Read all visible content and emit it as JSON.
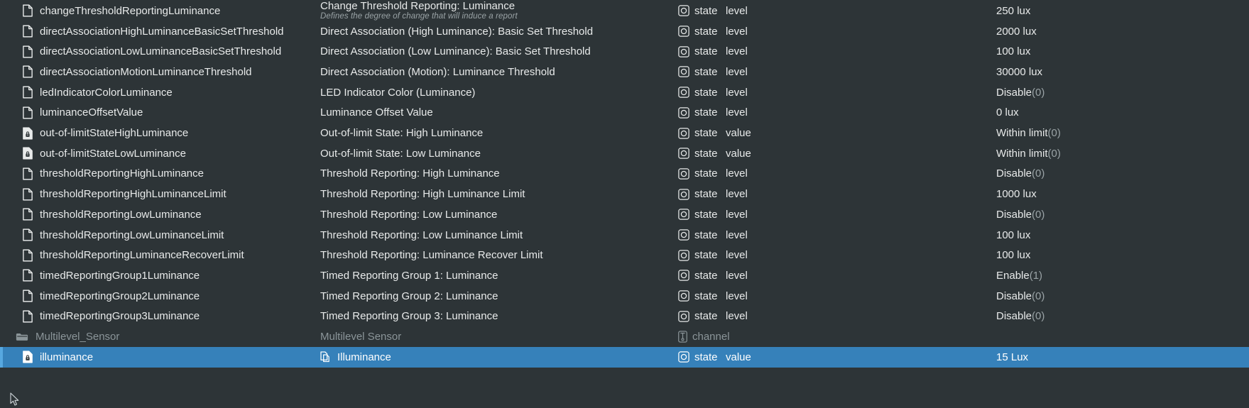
{
  "colors": {
    "background": "#2d3437",
    "selection": "#3681ba",
    "selection_accent": "#57a8e0",
    "text": "#e8eaea",
    "text_dim": "#8b9599"
  },
  "columns": {
    "name": "name",
    "description": "description",
    "type": "type",
    "property": "property",
    "value": "value"
  },
  "rows": [
    {
      "name": "changeThresholdReportingLuminance",
      "name_icon": "document-icon",
      "desc": "Change Threshold Reporting: Luminance",
      "desc_sub": "Defines the degree of change that will induce a report",
      "desc_icon": "",
      "type_icon": "state-circle-icon",
      "type": "state",
      "prop": "level",
      "value": "250 lux",
      "value_suffix": "",
      "selected": false,
      "group": false
    },
    {
      "name": "directAssociationHighLuminanceBasicSetThreshold",
      "name_icon": "document-icon",
      "desc": "Direct Association (High Luminance): Basic Set Threshold",
      "desc_sub": "",
      "desc_icon": "",
      "type_icon": "state-circle-icon",
      "type": "state",
      "prop": "level",
      "value": "2000 lux",
      "value_suffix": "",
      "selected": false,
      "group": false
    },
    {
      "name": "directAssociationLowLuminanceBasicSetThreshold",
      "name_icon": "document-icon",
      "desc": "Direct Association (Low Luminance): Basic Set Threshold",
      "desc_sub": "",
      "desc_icon": "",
      "type_icon": "state-circle-icon",
      "type": "state",
      "prop": "level",
      "value": "100 lux",
      "value_suffix": "",
      "selected": false,
      "group": false
    },
    {
      "name": "directAssociationMotionLuminanceThreshold",
      "name_icon": "document-icon",
      "desc": "Direct Association (Motion): Luminance Threshold",
      "desc_sub": "",
      "desc_icon": "",
      "type_icon": "state-circle-icon",
      "type": "state",
      "prop": "level",
      "value": "30000 lux",
      "value_suffix": "",
      "selected": false,
      "group": false
    },
    {
      "name": "ledIndicatorColorLuminance",
      "name_icon": "document-icon",
      "desc": "LED Indicator Color (Luminance)",
      "desc_sub": "",
      "desc_icon": "",
      "type_icon": "state-circle-icon",
      "type": "state",
      "prop": "level",
      "value": "Disable",
      "value_suffix": "(0)",
      "selected": false,
      "group": false
    },
    {
      "name": "luminanceOffsetValue",
      "name_icon": "document-icon",
      "desc": "Luminance Offset Value",
      "desc_sub": "",
      "desc_icon": "",
      "type_icon": "state-circle-icon",
      "type": "state",
      "prop": "level",
      "value": "0 lux",
      "value_suffix": "",
      "selected": false,
      "group": false
    },
    {
      "name": "out-of-limitStateHighLuminance",
      "name_icon": "document-locked-icon",
      "desc": "Out-of-limit State: High Luminance",
      "desc_sub": "",
      "desc_icon": "",
      "type_icon": "state-circle-icon",
      "type": "state",
      "prop": "value",
      "value": "Within limit",
      "value_suffix": "(0)",
      "selected": false,
      "group": false
    },
    {
      "name": "out-of-limitStateLowLuminance",
      "name_icon": "document-locked-icon",
      "desc": "Out-of-limit State: Low Luminance",
      "desc_sub": "",
      "desc_icon": "",
      "type_icon": "state-circle-icon",
      "type": "state",
      "prop": "value",
      "value": "Within limit",
      "value_suffix": "(0)",
      "selected": false,
      "group": false
    },
    {
      "name": "thresholdReportingHighLuminance",
      "name_icon": "document-icon",
      "desc": "Threshold Reporting: High Luminance",
      "desc_sub": "",
      "desc_icon": "",
      "type_icon": "state-circle-icon",
      "type": "state",
      "prop": "level",
      "value": "Disable",
      "value_suffix": "(0)",
      "selected": false,
      "group": false
    },
    {
      "name": "thresholdReportingHighLuminanceLimit",
      "name_icon": "document-icon",
      "desc": "Threshold Reporting: High Luminance Limit",
      "desc_sub": "",
      "desc_icon": "",
      "type_icon": "state-circle-icon",
      "type": "state",
      "prop": "level",
      "value": "1000 lux",
      "value_suffix": "",
      "selected": false,
      "group": false
    },
    {
      "name": "thresholdReportingLowLuminance",
      "name_icon": "document-icon",
      "desc": "Threshold Reporting: Low Luminance",
      "desc_sub": "",
      "desc_icon": "",
      "type_icon": "state-circle-icon",
      "type": "state",
      "prop": "level",
      "value": "Disable",
      "value_suffix": "(0)",
      "selected": false,
      "group": false
    },
    {
      "name": "thresholdReportingLowLuminanceLimit",
      "name_icon": "document-icon",
      "desc": "Threshold Reporting: Low Luminance Limit",
      "desc_sub": "",
      "desc_icon": "",
      "type_icon": "state-circle-icon",
      "type": "state",
      "prop": "level",
      "value": "100 lux",
      "value_suffix": "",
      "selected": false,
      "group": false
    },
    {
      "name": "thresholdReportingLuminanceRecoverLimit",
      "name_icon": "document-icon",
      "desc": "Threshold Reporting: Luminance Recover Limit",
      "desc_sub": "",
      "desc_icon": "",
      "type_icon": "state-circle-icon",
      "type": "state",
      "prop": "level",
      "value": "100 lux",
      "value_suffix": "",
      "selected": false,
      "group": false
    },
    {
      "name": "timedReportingGroup1Luminance",
      "name_icon": "document-icon",
      "desc": "Timed Reporting Group 1: Luminance",
      "desc_sub": "",
      "desc_icon": "",
      "type_icon": "state-circle-icon",
      "type": "state",
      "prop": "level",
      "value": "Enable",
      "value_suffix": "(1)",
      "selected": false,
      "group": false
    },
    {
      "name": "timedReportingGroup2Luminance",
      "name_icon": "document-icon",
      "desc": "Timed Reporting Group 2: Luminance",
      "desc_sub": "",
      "desc_icon": "",
      "type_icon": "state-circle-icon",
      "type": "state",
      "prop": "level",
      "value": "Disable",
      "value_suffix": "(0)",
      "selected": false,
      "group": false
    },
    {
      "name": "timedReportingGroup3Luminance",
      "name_icon": "document-icon",
      "desc": "Timed Reporting Group 3: Luminance",
      "desc_sub": "",
      "desc_icon": "",
      "type_icon": "state-circle-icon",
      "type": "state",
      "prop": "level",
      "value": "Disable",
      "value_suffix": "(0)",
      "selected": false,
      "group": false
    },
    {
      "name": "Multilevel_Sensor",
      "name_icon": "folder-icon",
      "desc": "Multilevel Sensor",
      "desc_sub": "",
      "desc_icon": "",
      "type_icon": "channel-icon",
      "type": "channel",
      "prop": "",
      "value": "",
      "value_suffix": "",
      "selected": false,
      "group": true
    },
    {
      "name": "illuminance",
      "name_icon": "document-locked-icon",
      "desc": "Illuminance",
      "desc_sub": "",
      "desc_icon": "copy-icon",
      "type_icon": "state-circle-icon",
      "type": "state",
      "prop": "value",
      "value": "15 Lux",
      "value_suffix": "",
      "selected": true,
      "group": false
    }
  ],
  "cursor": {
    "name": "mouse-pointer"
  }
}
